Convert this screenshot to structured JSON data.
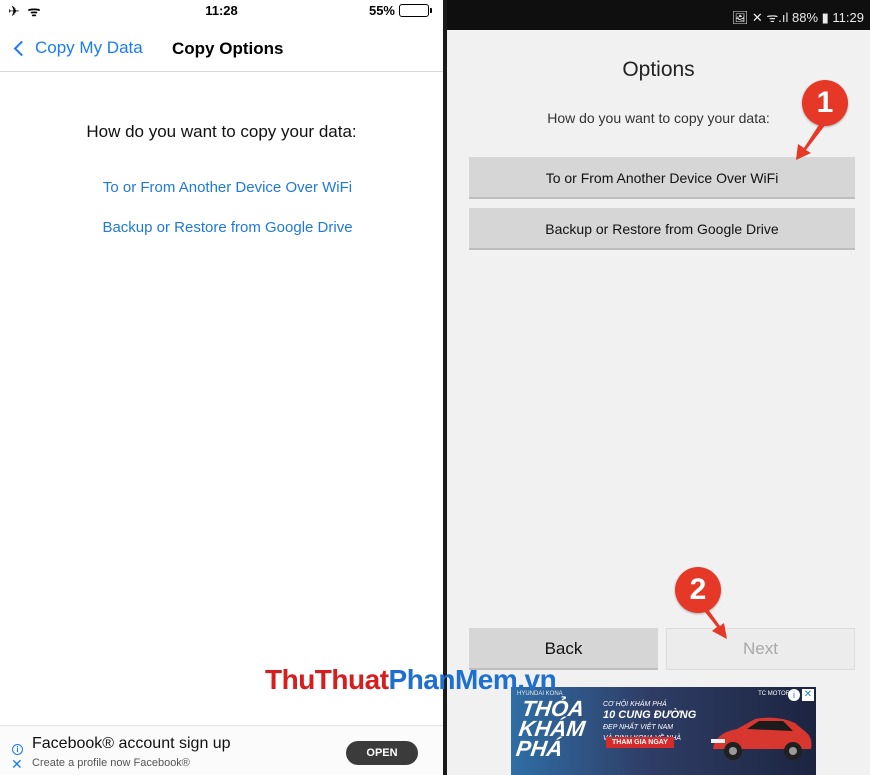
{
  "ios": {
    "status": {
      "left_icons": "✈ ᯤ",
      "time": "11:28",
      "battery": "55%"
    },
    "nav": {
      "back_label": "Copy My Data",
      "title": "Copy Options"
    },
    "question": "How do you want to copy your data:",
    "options": {
      "wifi": "To or From Another Device Over WiFi",
      "drive": "Backup or Restore from Google Drive"
    },
    "ad": {
      "title": "Facebook® account sign up",
      "subtitle": "Create a profile now Facebook®",
      "open_label": "OPEN"
    }
  },
  "android": {
    "status": {
      "icons": "🖼 ✕ ᯤ.ıl 88% ▮ 11:29"
    },
    "title": "Options",
    "question": "How do you want to copy your data:",
    "buttons": {
      "wifi": "To or From Another Device Over WiFi",
      "drive": "Backup or Restore from Google Drive",
      "back": "Back",
      "next": "Next"
    }
  },
  "markers": {
    "one": "1",
    "two": "2"
  },
  "watermark": {
    "part1": "ThuThuat",
    "part2": "PhanMem.vn"
  },
  "right_ad": {
    "brand": "HYUNDAI KONA",
    "thoa": "THỎA",
    "kham": "KHÁM",
    "pha": "PHÁ",
    "line1": "CƠ HỘI KHÁM PHÁ",
    "line2": "10 CUNG ĐƯỜNG",
    "line3": "ĐẸP NHẤT VIỆT NAM",
    "line4": "VÀ RINH KONA VỀ NHÀ",
    "cta": "THAM GIA NGAY",
    "maker": "TC MOTOR"
  },
  "colors": {
    "ios_link": "#1f79d9",
    "marker": "#e53827",
    "android_button": "#d6d6d6"
  }
}
